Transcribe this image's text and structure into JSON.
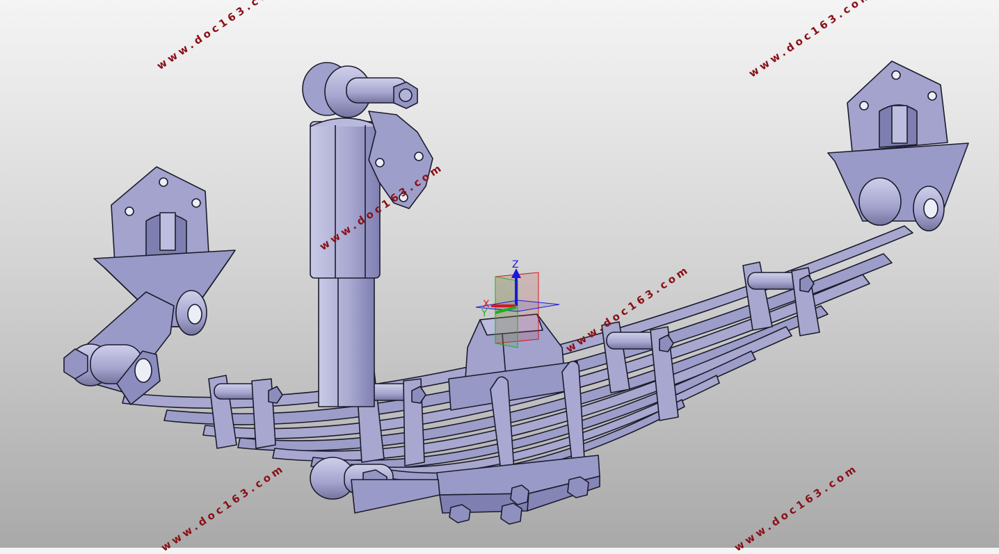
{
  "viewport": {
    "background_top": "#f4f4f4",
    "background_bottom": "#a9a9a9",
    "part_color": "#a7a7cf",
    "part_shadow": "#7d7db0",
    "edge_color": "#1b1b2c"
  },
  "triad": {
    "z_label": "Z",
    "x_label": "X",
    "y_label": "Y",
    "z_color": "#1a1adb",
    "x_color": "#d61a1a",
    "y_color": "#19b21e"
  },
  "watermarks": [
    {
      "text": "www.doc163.com"
    },
    {
      "text": "www.doc163.com"
    },
    {
      "text": "www.doc163.com"
    },
    {
      "text": "www.doc163.com"
    },
    {
      "text": "www.doc163.com"
    },
    {
      "text": "www.doc163.com"
    },
    {
      "text": "www.doc163.com"
    }
  ]
}
